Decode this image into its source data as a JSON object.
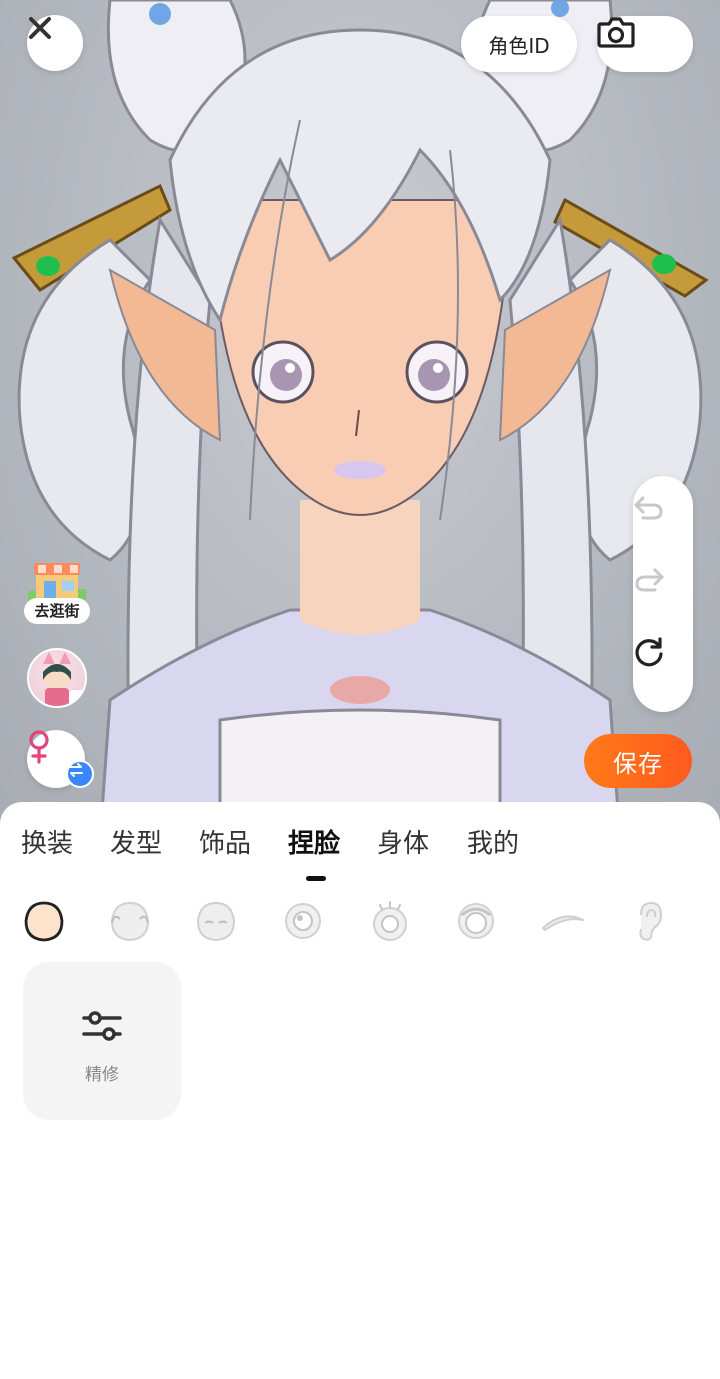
{
  "header": {
    "close_icon": "close-icon",
    "role_id_label": "角色ID",
    "camera_icon": "camera-icon"
  },
  "side_left": {
    "shop_label": "去逛街",
    "gender_icon": "female-icon",
    "swap_icon": "swap-icon"
  },
  "history": {
    "undo_icon": "undo-icon",
    "redo_icon": "redo-icon",
    "reset_icon": "reset-icon"
  },
  "save_label": "保存",
  "tabs": [
    {
      "label": "换装",
      "active": false
    },
    {
      "label": "发型",
      "active": false
    },
    {
      "label": "饰品",
      "active": false
    },
    {
      "label": "捏脸",
      "active": true
    },
    {
      "label": "身体",
      "active": false
    },
    {
      "label": "我的",
      "active": false
    }
  ],
  "sub_categories": [
    {
      "icon": "face-skin-icon",
      "selected": true
    },
    {
      "icon": "face-shape-icon",
      "selected": false
    },
    {
      "icon": "face-features-icon",
      "selected": false
    },
    {
      "icon": "eye-icon",
      "selected": false
    },
    {
      "icon": "eyelash-icon",
      "selected": false
    },
    {
      "icon": "pupil-icon",
      "selected": false
    },
    {
      "icon": "eyebrow-icon",
      "selected": false
    },
    {
      "icon": "ear-icon",
      "selected": false
    }
  ],
  "refine": {
    "label": "精修",
    "icon": "sliders-icon"
  },
  "colors": {
    "save_button": "#ff6a1c",
    "active_tab": "#111111",
    "swap_badge": "#3a86ff",
    "gender_icon": "#e0457b"
  }
}
